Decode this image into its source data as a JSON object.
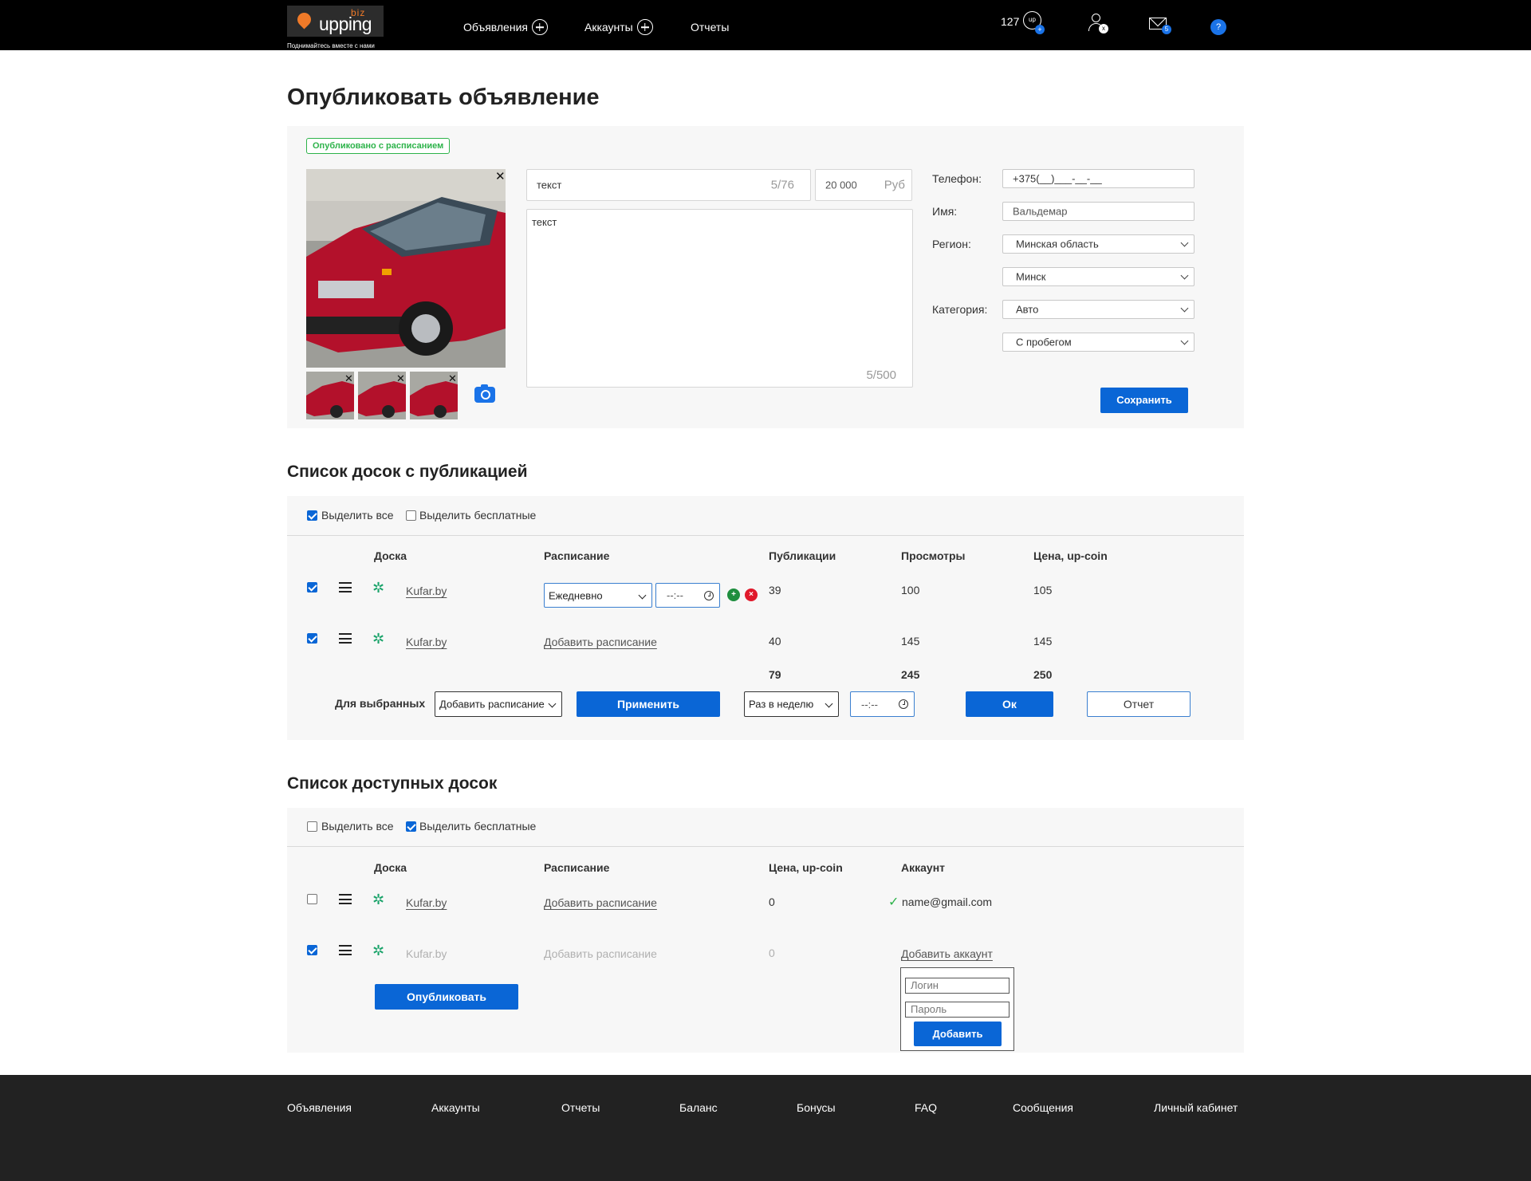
{
  "header": {
    "logo_text": "upping",
    "logo_suffix": "biz",
    "slogan": "Поднимайтесь вместе с нами",
    "nav": [
      "Объявления",
      "Аккаунты",
      "Отчеты"
    ],
    "coins": "127",
    "coin_icon_label": "up",
    "user_badge": "x",
    "mail_badge": "5",
    "help": "?"
  },
  "page_title": "Опубликовать объявление",
  "ad": {
    "status_badge": "Опубликовано с расписанием",
    "title_value": "текст",
    "title_counter": "5/76",
    "price_value": "20 000",
    "price_currency": "Руб",
    "description_value": "текст",
    "description_counter": "5/500",
    "phone_label": "Телефон:",
    "phone_value": "+375(__)___-__-__",
    "name_label": "Имя:",
    "name_value": "Вальдемар",
    "region_label": "Регион:",
    "region_value": "Минская область",
    "city_value": "Минск",
    "category_label": "Категория:",
    "category_value": "Авто",
    "subcategory_value": "С пробегом",
    "save_label": "Сохранить"
  },
  "published": {
    "title": "Список досок с публикацией",
    "select_all": "Выделить все",
    "select_free": "Выделить бесплатные",
    "columns": [
      "Доска",
      "Расписание",
      "Публикации",
      "Просмотры",
      "Цена, up-coin"
    ],
    "rows": [
      {
        "board": "Kufar.by",
        "schedule": "Ежедневно",
        "time": "--:--",
        "publications": "39",
        "views": "100",
        "price": "105"
      },
      {
        "board": "Kufar.by",
        "schedule": "Добавить расписание",
        "publications": "40",
        "views": "145",
        "price": "145"
      }
    ],
    "totals": {
      "publications": "79",
      "views": "245",
      "price": "250"
    },
    "for_selected": "Для выбранных",
    "bulk_select": "Добавить расписание",
    "apply": "Применить",
    "frequency": "Раз в неделю",
    "time": "--:--",
    "ok": "Ок",
    "report": "Отчет"
  },
  "available": {
    "title": "Список доступных досок",
    "select_all": "Выделить все",
    "select_free": "Выделить бесплатные",
    "columns": [
      "Доска",
      "Расписание",
      "Цена, up-coin",
      "Аккаунт"
    ],
    "rows": [
      {
        "board": "Kufar.by",
        "schedule": "Добавить расписание",
        "price": "0",
        "account": "name@gmail.com"
      },
      {
        "board": "Kufar.by",
        "schedule": "Добавить расписание",
        "price": "0",
        "account": "Добавить аккаунт"
      }
    ],
    "login_placeholder": "Логин",
    "password_placeholder": "Пароль",
    "add_label": "Добавить",
    "publish_label": "Опубликовать"
  },
  "footer": [
    "Объявления",
    "Аккаунты",
    "Отчеты",
    "Баланс",
    "Бонусы",
    "FAQ",
    "Сообщения",
    "Личный кабинет"
  ]
}
